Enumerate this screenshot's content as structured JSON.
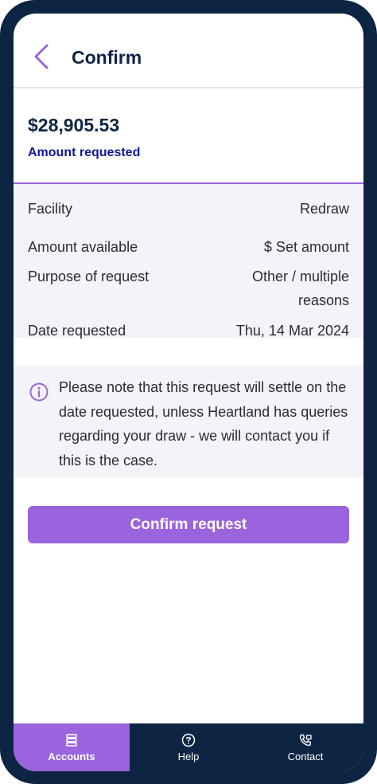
{
  "header": {
    "title": "Confirm",
    "back_icon": "chevron-left-icon"
  },
  "amount": {
    "value": "$28,905.53",
    "label": "Amount requested"
  },
  "details": [
    {
      "key": "Facility",
      "value": "Redraw"
    },
    {
      "key": "Amount available",
      "value": "$ Set amount"
    },
    {
      "key": "Purpose of request",
      "value": "Other / multiple reasons"
    },
    {
      "key": "Date requested",
      "value": "Thu, 14 Mar 2024"
    }
  ],
  "notice": {
    "icon": "info-icon",
    "text": "Please note that this request will settle on the date requested, unless Heartland has queries regarding your draw -  we will contact you if this is the case."
  },
  "confirm_button": {
    "label": "Confirm request"
  },
  "tabs": [
    {
      "label": "Accounts",
      "icon": "accounts-icon",
      "active": true
    },
    {
      "label": "Help",
      "icon": "help-icon",
      "active": false
    },
    {
      "label": "Contact",
      "icon": "phone-icon",
      "active": false
    }
  ],
  "colors": {
    "accent": "#9b63dd",
    "navy": "#0d2543",
    "label_blue": "#12169e",
    "panel": "#f4f4f8"
  }
}
